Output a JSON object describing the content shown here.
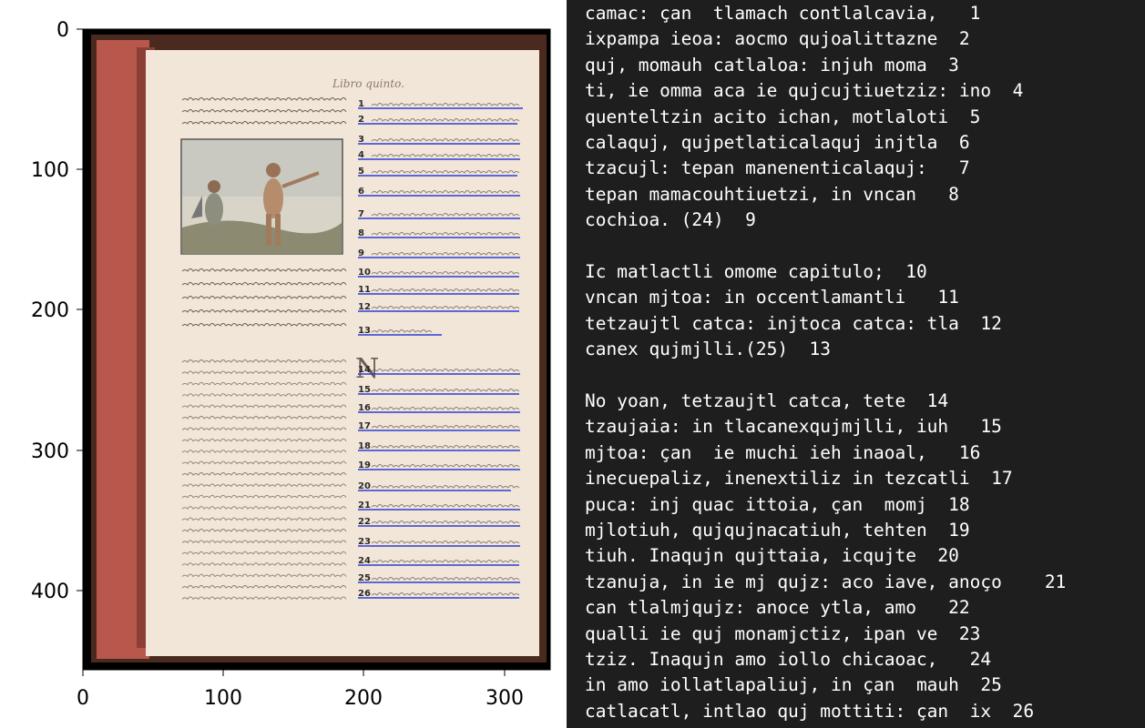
{
  "plot": {
    "y_ticks": [
      "0",
      "100",
      "200",
      "300",
      "400"
    ],
    "x_ticks": [
      "0",
      "100",
      "200",
      "300"
    ],
    "line_numbers": [
      "1",
      "2",
      "3",
      "4",
      "5",
      "6",
      "7",
      "8",
      "9",
      "10",
      "11",
      "12",
      "13",
      "14",
      "15",
      "16",
      "17",
      "18",
      "19",
      "20",
      "21",
      "22",
      "23",
      "24",
      "25",
      "26"
    ],
    "page_header": "Libro quinto.",
    "colors": {
      "annotation_line": "#2d3dd6",
      "paper": "#f2e6d9",
      "page_edge": "#b8574b",
      "background": "#000000"
    }
  },
  "terminal": {
    "lines": [
      "camac: çan  tlamach contlalcavia,   1",
      "ixpampa ieoa: aocmo qujoalittazne  2",
      "quj, momauh catlaloa: injuh moma  3",
      "ti, ie omma aca ie qujcujtiuetziz: ino  4",
      "quenteltzin acito ichan, motlaloti  5",
      "calaquj, qujpetlaticalaquj injtla  6",
      "tzacujl: tepan manenenticalaquj:   7",
      "tepan mamacouhtiuetzi, in vncan   8",
      "cochioa. (24)  9",
      "",
      "Ic matlactli omome capitulo;  10",
      "vncan mjtoa: in occentlamantli   11",
      "tetzaujtl catca: injtoca catca: tla  12",
      "canex qujmjlli.(25)  13",
      "",
      "No yoan, tetzaujtl catca, tete  14",
      "tzaujaia: in tlacanexqujmjlli, iuh   15",
      "mjtoa: çan  ie muchi ieh inaoal,   16",
      "inecuepaliz, inenextiliz in tezcatli  17",
      "puca: inj quac ittoia, çan  momj  18",
      "mjlotiuh, qujqujnacatiuh, tehten  19",
      "tiuh. Inaqujn qujttaia, icqujte  20",
      "tzanuja, in ie mj qujz: aco iave, anoço    21",
      "can tlalmjqujz: anoce ytla, amo   22",
      "qualli ie quj monamjctiz, ipan ve  23",
      "tziz. Inaqujn amo iollo chicaoac,   24",
      "in amo iollatlapaliuj, in çan  mauh  25",
      "catlacatl, intlao quj mottiti: çan  ix  26"
    ]
  }
}
